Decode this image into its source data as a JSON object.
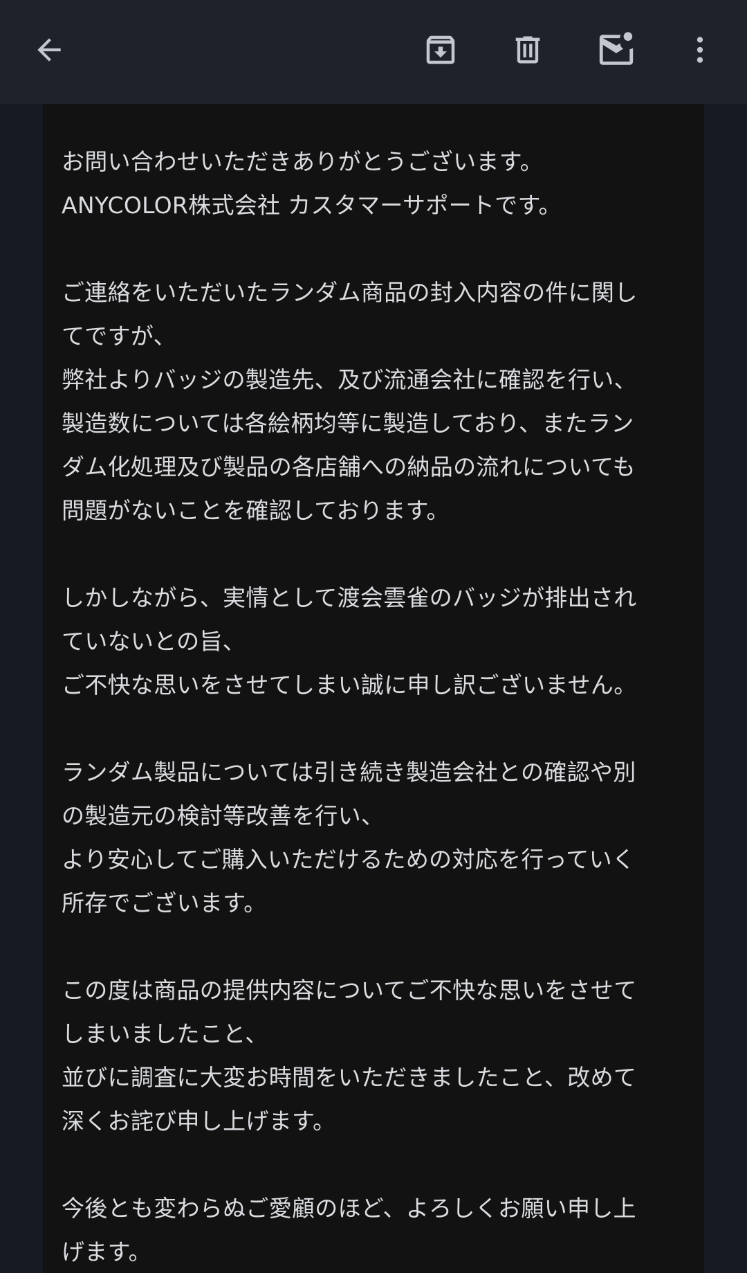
{
  "toolbar": {
    "back_icon": "arrow-back-icon",
    "archive_icon": "archive-icon",
    "delete_icon": "trash-icon",
    "mark_unread_icon": "mail-unread-icon",
    "more_icon": "more-vert-icon"
  },
  "message": {
    "lines": [
      "お問い合わせいただきありがとうございます。",
      "ANYCOLOR株式会社 カスタマーサポートです。",
      "",
      "ご連絡をいただいたランダム商品の封入内容の件に関し",
      "てですが、",
      "弊社よりバッジの製造先、及び流通会社に確認を行い、",
      "製造数については各絵柄均等に製造しており、またラン",
      "ダム化処理及び製品の各店舗への納品の流れについても",
      "問題がないことを確認しております。",
      "",
      "しかしながら、実情として渡会雲雀のバッジが排出され",
      "ていないとの旨、",
      "ご不快な思いをさせてしまい誠に申し訳ございません。",
      "",
      "ランダム製品については引き続き製造会社との確認や別",
      "の製造元の検討等改善を行い、",
      "より安心してご購入いただけるための対応を行っていく",
      "所存でございます。",
      "",
      "この度は商品の提供内容についてご不快な思いをさせて",
      "しまいましたこと、",
      "並びに調査に大変お時間をいただきましたこと、改めて",
      "深くお詫び申し上げます。",
      "",
      "今後とも変わらぬご愛顧のほど、よろしくお願い申し上",
      "げます。"
    ]
  }
}
